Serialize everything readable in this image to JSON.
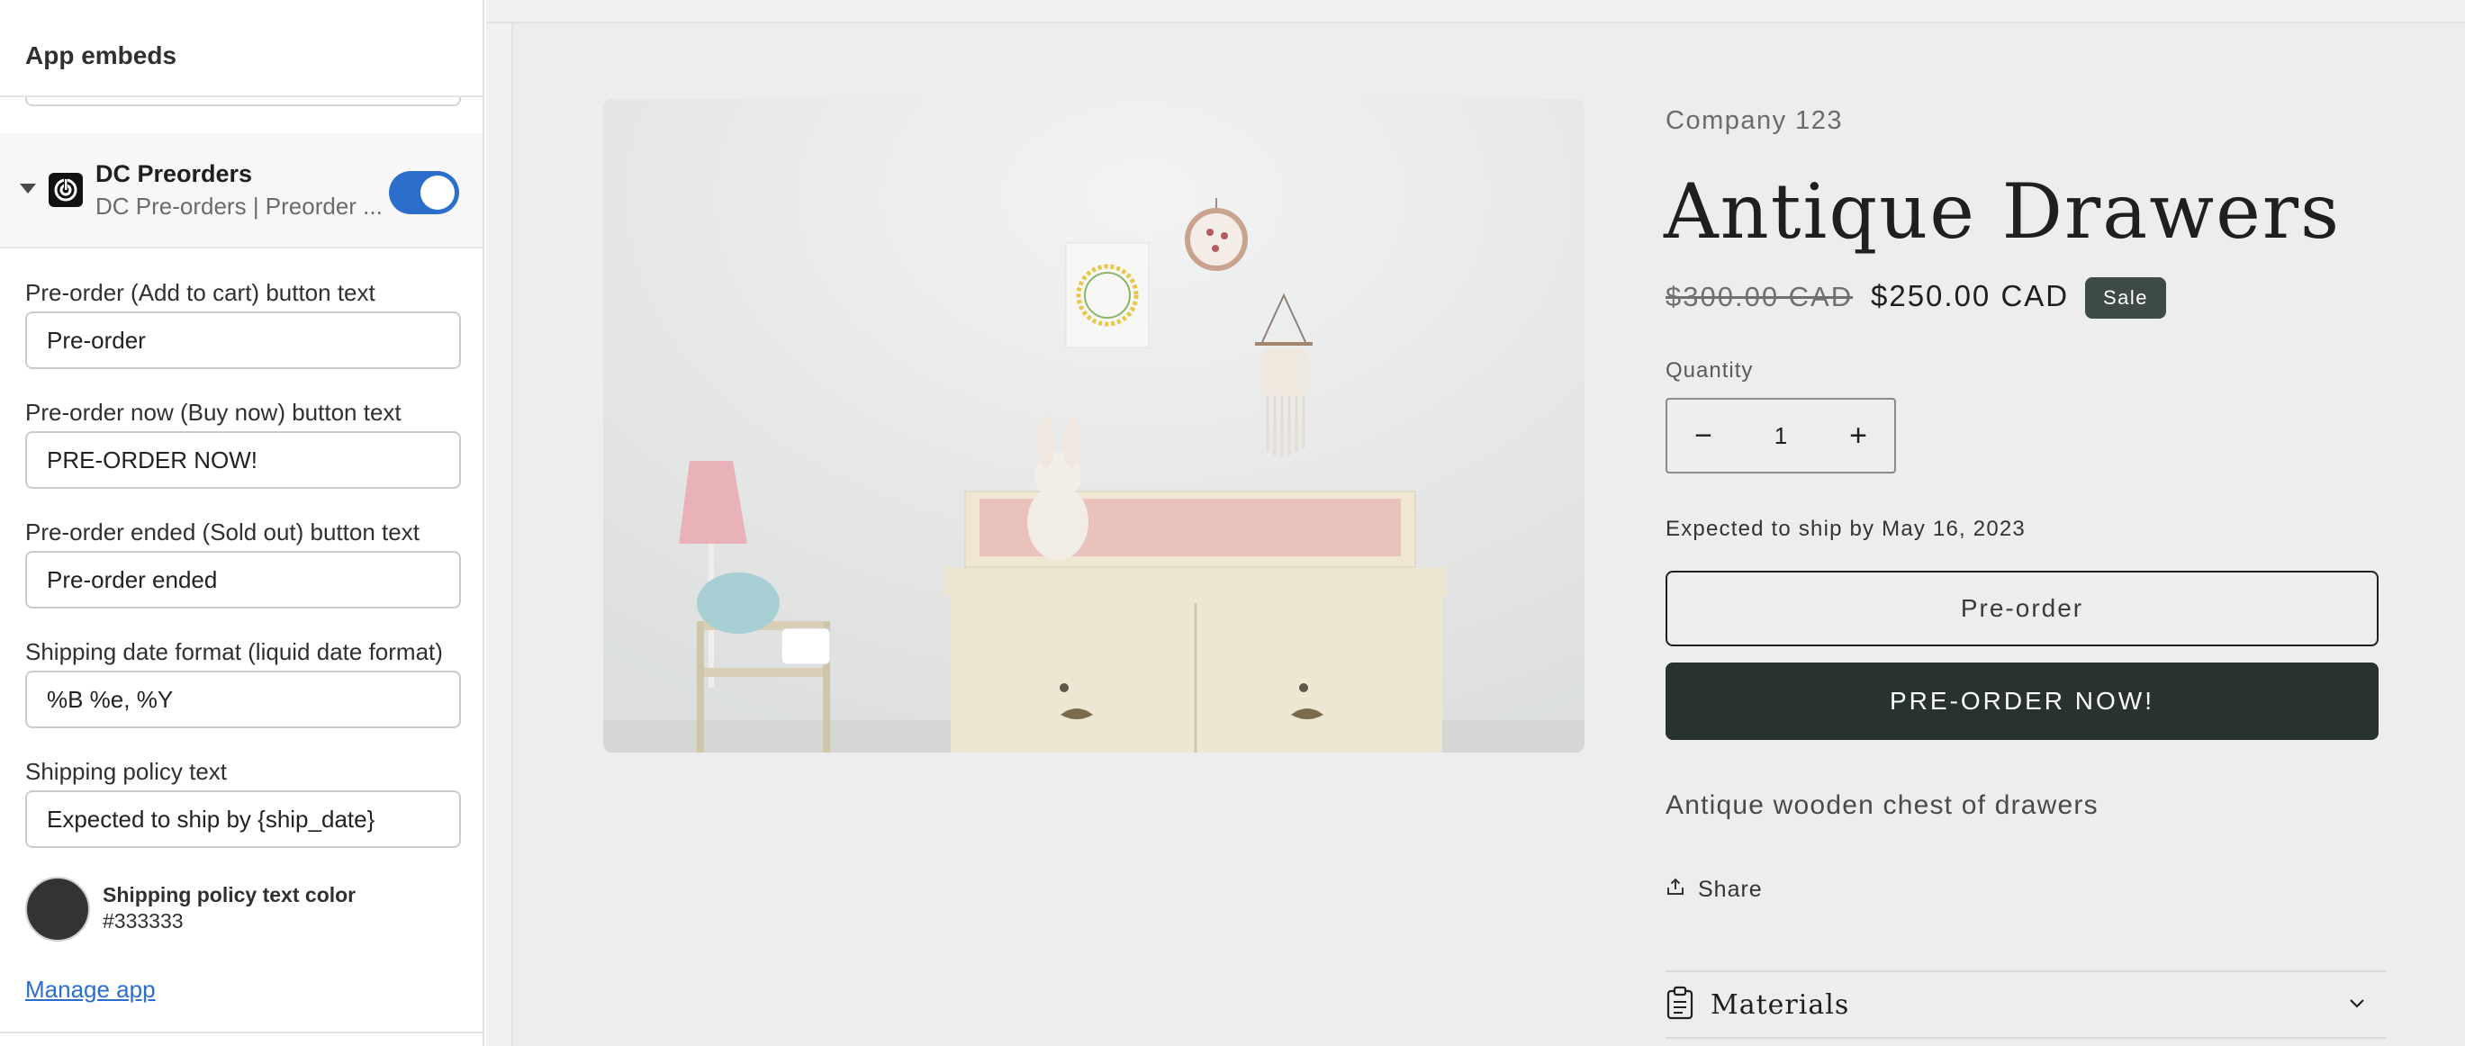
{
  "sidebar": {
    "header_title": "App embeds",
    "app": {
      "name": "DC Preorders",
      "subtitle": "DC Pre-orders | Preorder ...",
      "enabled": true
    },
    "fields": [
      {
        "label": "Pre-order (Add to cart) button text",
        "value": "Pre-order"
      },
      {
        "label": "Pre-order now (Buy now) button text",
        "value": "PRE-ORDER NOW!"
      },
      {
        "label": "Pre-order ended (Sold out) button text",
        "value": "Pre-order ended"
      },
      {
        "label": "Shipping date format (liquid date format)",
        "value": "%B %e, %Y"
      },
      {
        "label": "Shipping policy text",
        "value": "Expected to ship by {ship_date}"
      }
    ],
    "color_setting": {
      "title": "Shipping policy text color",
      "value": "#333333"
    },
    "manage_link": "Manage app"
  },
  "product": {
    "vendor": "Company 123",
    "title": "Antique Drawers",
    "compare_price": "$300.00 CAD",
    "sale_price": "$250.00 CAD",
    "badge": "Sale",
    "quantity_label": "Quantity",
    "quantity_minus": "−",
    "quantity_value": "1",
    "quantity_plus": "+",
    "shipping_text": "Expected to ship by May 16, 2023",
    "preorder_button": "Pre-order",
    "preorder_now_button": "PRE-ORDER NOW!",
    "description": "Antique wooden chest of drawers",
    "share_label": "Share",
    "accordion_label": "Materials"
  },
  "colors": {
    "toggle_on": "#2c6ecb",
    "link": "#2c6ecb",
    "buy_button": "#283330",
    "badge": "#3e4a44",
    "preview_bg": "#eeedee"
  },
  "icons": [
    "caret-down-icon",
    "app-logo-icon",
    "share-icon",
    "clipboard-icon",
    "chevron-down-icon"
  ]
}
